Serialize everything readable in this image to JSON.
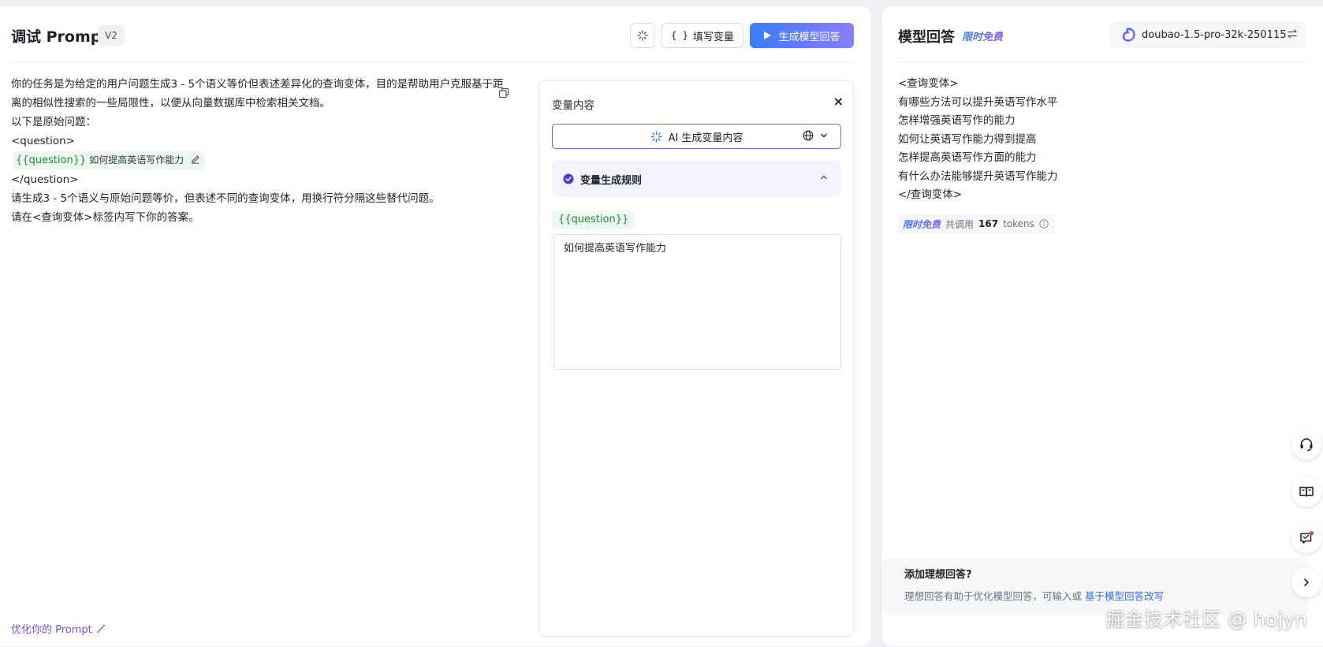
{
  "left": {
    "title": "调试 Prompt",
    "version": "V2",
    "fill_variables_label": "填写变量",
    "braces_glyph": "{ }",
    "generate_label": "生成模型回答",
    "prompt_lines": [
      "你的任务是为给定的用户问题生成3 - 5个语义等价但表述差异化的查询变体，目的是帮助用户克服基于距",
      "离的相似性搜索的一些局限性，以便从向量数据库中检索相关文档。",
      "以下是原始问题：",
      "<question>"
    ],
    "variable_chip": {
      "name": "{{question}}",
      "value": "如何提高英语写作能力"
    },
    "prompt_lines_after": [
      "</question>",
      "请生成3 - 5个语义与原始问题等价，但表述不同的查询变体，用换行符分隔这些替代问题。",
      "请在<查询变体>标签内写下你的答案。"
    ],
    "optimize_label": "优化你的 Prompt"
  },
  "variables": {
    "title": "变量内容",
    "close_glyph": "×",
    "ai_generate_label": "AI 生成变量内容",
    "rule_label": "变量生成规则",
    "var_tag": "{{question}}",
    "var_value": "如何提高英语写作能力"
  },
  "right": {
    "title": "模型回答",
    "free_badge": "限时免费",
    "model_name": "doubao-1.5-pro-32k-250115",
    "answer_lines": [
      "<查询变体>",
      "有哪些方法可以提升英语写作水平",
      "怎样增强英语写作的能力",
      "如何让英语写作能力得到提高",
      "怎样提高英语写作方面的能力",
      "有什么办法能够提升英语写作能力",
      "</查询变体>"
    ],
    "usage": {
      "free": "限时免费",
      "prefix": "共调用",
      "count": "167",
      "unit": "tokens"
    },
    "ideal_title": "添加理想回答?",
    "ideal_desc": "理想回答有助于优化模型回答，可输入或 ",
    "ideal_link": "基于模型回答改写"
  },
  "watermark": "掘金技术社区 @ hojyn",
  "colors": {
    "accent_purple": "#7b5cf0",
    "accent_blue": "#3b7cff",
    "variable_green": "#1e8a3c"
  },
  "icons": [
    "sparkle-icon",
    "braces-icon",
    "play-icon",
    "copy-icon",
    "magic-wand-icon",
    "close-icon",
    "globe-icon",
    "chevron-down-icon",
    "check-circle-icon",
    "chevron-up-icon",
    "model-logo-icon",
    "swap-icon",
    "info-icon",
    "headset-icon",
    "book-icon",
    "feedback-icon",
    "chevron-right-icon"
  ]
}
